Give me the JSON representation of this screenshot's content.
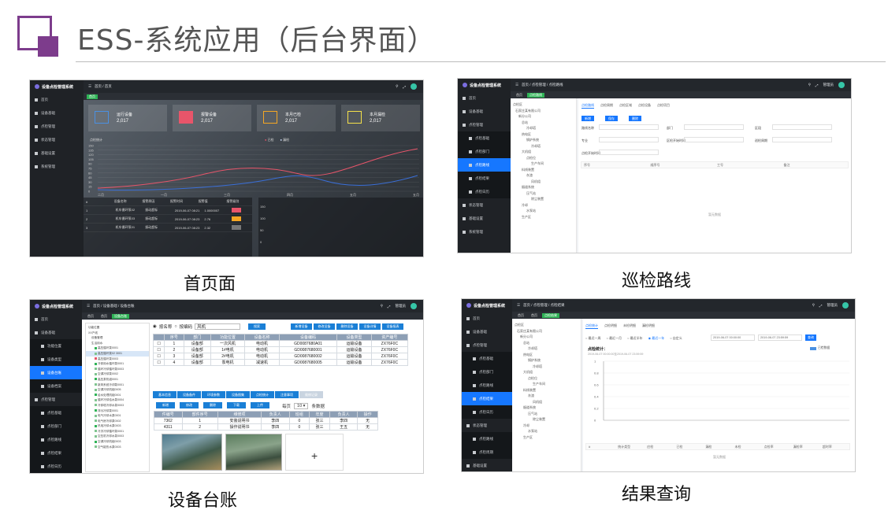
{
  "slide": {
    "title": "ESS-系统应用（后台界面）",
    "captions": [
      "首页面",
      "巡检路线",
      "设备台账",
      "结果查询"
    ]
  },
  "app": {
    "brand": "设备点检管理系统",
    "admin": "管理员"
  },
  "home": {
    "breadcrumb": "首页 / 首页",
    "tab": "首页",
    "menu": [
      "首页",
      "设备基础",
      "点检管理",
      "状态管理",
      "基础设置",
      "系统管理"
    ],
    "cards": [
      {
        "label": "运行设备",
        "value": "2,017"
      },
      {
        "label": "报警设备",
        "value": "2,017"
      },
      {
        "label": "本月已检",
        "value": "2,017"
      },
      {
        "label": "本月漏检",
        "value": "2,017"
      }
    ],
    "chart_title": "点检统计",
    "chart_legend": [
      "已检",
      "漏检"
    ],
    "chart_y_ticks": [
      "150",
      "135",
      "120",
      "105",
      "90",
      "75",
      "60",
      "45",
      "30",
      "15",
      "0"
    ],
    "chart_x_ticks": [
      "二月",
      "一月",
      "三月",
      "四月",
      "五月",
      "五月"
    ],
    "table_headers": [
      "#",
      "设备名称",
      "报警原因",
      "报警时间",
      "报警值",
      "报警级别"
    ],
    "table_rows": [
      [
        "1",
        "机车循环泵02",
        "振动超标",
        "2019-06-07 08:21",
        "1.0000007",
        ""
      ],
      [
        "2",
        "机车循环泵03",
        "振动超标",
        "2019-06-07 08:23",
        "2.76",
        ""
      ],
      [
        "3",
        "机车循环泵01",
        "振动超标",
        "2019-06-07 08:23",
        "2.32",
        ""
      ]
    ],
    "mini_axis": [
      "150",
      "100",
      "50",
      "0"
    ]
  },
  "route": {
    "breadcrumb": "首页 / 点检管理 / 点检路线",
    "tabs": [
      "首页",
      "点检路线"
    ],
    "menu": [
      "首页",
      "设备基础",
      "点检管理",
      "点检基础",
      "点检部门",
      "点检路线",
      "点检结果",
      "点检日历",
      "状态管理",
      "基础设置",
      "系统管理"
    ],
    "tree_title": "点检区",
    "tree": [
      "石家庄某有限公司",
      "新分公司",
      "总站",
      "冷却塔",
      "热电区",
      "锅炉系统",
      "冷却塔",
      "大机组",
      "点检位",
      "生产车间",
      "料线装置",
      "灰渣",
      "风机组",
      "烟道系统",
      "压气站",
      "除尘装置",
      "冷却",
      "水泵站",
      "生产区"
    ],
    "form_tabs": [
      "点检路线",
      "点检周期",
      "点检区域",
      "点检设备",
      "点检项目"
    ],
    "buttons": [
      "新增",
      "保存",
      "删除"
    ],
    "fields": [
      "路线名称",
      "部门",
      "区段",
      "专业",
      "区检开始时间",
      "巡检周期",
      "点检开始时间",
      "巡检周期",
      "路线类型",
      "维修时间"
    ],
    "table_headers": [
      "序号",
      "顺序号",
      "工号",
      "备注"
    ],
    "empty": "暂无数据"
  },
  "ledger": {
    "breadcrumb": "首页 / 设备基础 / 设备台账",
    "tabs": [
      "首页",
      "首页",
      "设备台账"
    ],
    "menu": [
      "首页",
      "设备基础",
      "功能位置",
      "设备类型",
      "设备台账",
      "设备档案",
      "点检管理",
      "点检基础",
      "点检部门",
      "点检路线",
      "点检结果",
      "点检日历",
      "状态管理"
    ],
    "tree_title": "功能位置",
    "tree": [
      "XX产线",
      "设备管理",
      "生活用水",
      "高压循环泵0001",
      "高压循环泵02 3001",
      "高压循环泵0003",
      "冷却用水循环泵0001",
      "循环冷却循环泵0003",
      "空调冷却泵0002",
      "高压泵机组0001",
      "新风系统冷却泵0001",
      "空调冷却机组0005",
      "给水处理机组0001",
      "循环冷却给水泵0004",
      "冷却塔冷却水泵0003",
      "排污冷却泵0001",
      "电气冷却水泵0001",
      "电气房冷却泵0002",
      "热电冷却水泵0003",
      "冷冻冷却循环泵0001",
      "空压机冷却水泵0003",
      "空调冷却机组0003",
      "空气能热水泵0003"
    ],
    "search_labels": [
      "按名称",
      "按编码"
    ],
    "search_value": "风机",
    "search_button": "搜索",
    "action_buttons": [
      "新增设备",
      "修改设备",
      "删除设备",
      "设备详情",
      "设备报表"
    ],
    "table_headers": [
      "",
      "序号",
      "部门",
      "功能位置",
      "设备名称",
      "设备编码",
      "设备类型",
      "资产编号"
    ],
    "table_rows": [
      [
        "1",
        "设备部",
        "一次风机",
        "电动机",
        "GD0087680A01",
        "运输设备",
        "ZX76F0C"
      ],
      [
        "2",
        "设备部",
        "1#电机",
        "电动机",
        "GD0087680001",
        "运输设备",
        "ZX76F0C"
      ],
      [
        "3",
        "设备部",
        "2#电机",
        "电动机",
        "GD0087680002",
        "运输设备",
        "ZX76F0C"
      ],
      [
        "4",
        "设备部",
        "泵电机",
        "减速机",
        "GD0087680005",
        "运输设备",
        "ZX76F0C"
      ]
    ],
    "sub_tabs": [
      "基本信息",
      "设备备件",
      "环境参数",
      "设备图集",
      "点检统计",
      "注意事项",
      "维修记录"
    ],
    "sub_buttons": [
      "新增",
      "修改",
      "删除",
      "下载",
      "上传"
    ],
    "pager_label": "每页",
    "pager_value": "10",
    "pager_unit": "条数据",
    "spare_headers": [
      "件编号",
      "部件序号",
      "维修项",
      "负责人",
      "班组",
      "年度",
      "负责人",
      "操作"
    ],
    "spare_rows": [
      [
        "7362",
        "1",
        "安装说明书",
        "李四",
        "0",
        "张三",
        "李四",
        "无"
      ],
      [
        "4311",
        "2",
        "操作说明书",
        "李四",
        "0",
        "张三",
        "王五",
        "无"
      ]
    ],
    "plus": "+"
  },
  "result": {
    "breadcrumb": "首页 / 点检管理 / 点检结果",
    "tabs": [
      "首页",
      "首页",
      "点检结果"
    ],
    "menu": [
      "首页",
      "设备基础",
      "点检管理",
      "点检基础",
      "点检部门",
      "点检路线",
      "点检结果",
      "点检日历",
      "状态管理",
      "点检路线",
      "点检周期",
      "基础设置",
      "系统管理"
    ],
    "tree_title": "点检区",
    "tree": [
      "石家庄某有限公司",
      "新分公司",
      "总站",
      "冷却塔",
      "热电区",
      "锅炉系统",
      "冷却塔",
      "大机组",
      "点检位",
      "生产车间",
      "料线装置",
      "灰渣",
      "风机组",
      "烟道系统",
      "压气站",
      "除尘装置",
      "冷却",
      "水泵站",
      "生产区"
    ],
    "form_tabs": [
      "点检统计",
      "点检明细",
      "未检明细",
      "漏检明细"
    ],
    "radios": [
      "最近一周",
      "最近一月",
      "最近半年",
      "最近一年",
      "自定义"
    ],
    "date_from": "2019-06-07 00:00:00",
    "date_to": "2019-06-07 23:59:59",
    "query_button": "查询",
    "stat_title": "点检统计：",
    "stat_range": "2019-06-07 00:00:00至2019-06-07 23:59:59",
    "legend": "已检数据",
    "y_ticks": [
      "1",
      "0.8",
      "0.6",
      "0.4",
      "0.2",
      "0"
    ],
    "table_headers": [
      "#",
      "统计类型",
      "应检",
      "已检",
      "漏检",
      "未检",
      "点检率",
      "漏检率",
      "超时率"
    ],
    "empty": "暂无数据"
  }
}
